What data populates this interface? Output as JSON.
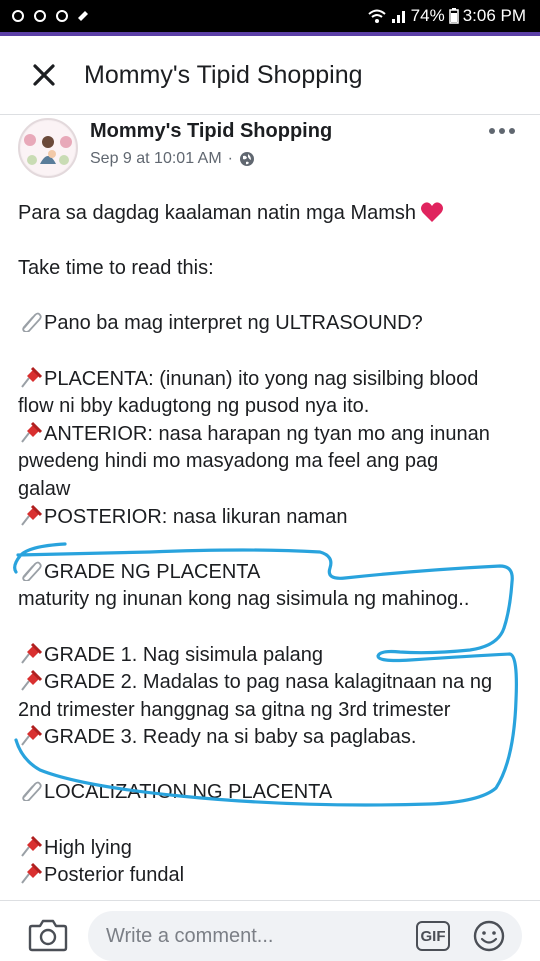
{
  "status_bar": {
    "battery": "74%",
    "time": "3:06 PM"
  },
  "header": {
    "title": "Mommy's Tipid Shopping"
  },
  "post": {
    "author": "Mommy's Tipid Shopping",
    "timestamp": "Sep 9 at 10:01 AM",
    "separator": "·",
    "lines": {
      "l1": "Para sa dagdag kaalaman natin mga Mamsh",
      "l2": "Take time to read this:",
      "l3": "Pano ba mag interpret ng ULTRASOUND?",
      "l4": "PLACENTA: (inunan) ito yong nag sisilbing blood",
      "l5": "flow ni bby kadugtong ng pusod nya ito.",
      "l6": "ANTERIOR: nasa harapan ng tyan mo ang inunan",
      "l7": "pwedeng hindi mo masyadong ma feel ang pag",
      "l8": "galaw",
      "l9": "POSTERIOR: nasa likuran naman",
      "l10": "GRADE NG PLACENTA",
      "l11": "maturity ng inunan kong nag sisimula ng mahinog..",
      "l12": "GRADE 1. Nag sisimula palang",
      "l13": "GRADE 2. Madalas to pag nasa kalagitnaan na ng",
      "l14": "2nd trimester hanggnag sa gitna ng 3rd trimester",
      "l15": "GRADE 3. Ready na si baby sa paglabas.",
      "l16": "LOCALIZATION NG PLACENTA",
      "l17": "High lying",
      "l18": "Posterior fundal"
    }
  },
  "comment_bar": {
    "placeholder": "Write a comment...",
    "gif_label": "GIF"
  },
  "colors": {
    "accent": "#5b3fa6",
    "annotation": "#29a3dd",
    "heart": "#e0245e",
    "pin": "#d93030"
  },
  "icons": [
    "close-icon",
    "more-icon",
    "globe-icon",
    "pin-icon",
    "paperclip-icon",
    "heart-icon",
    "camera-icon",
    "gif-icon",
    "emoji-icon",
    "wifi-icon",
    "signal-icon",
    "battery-icon"
  ]
}
